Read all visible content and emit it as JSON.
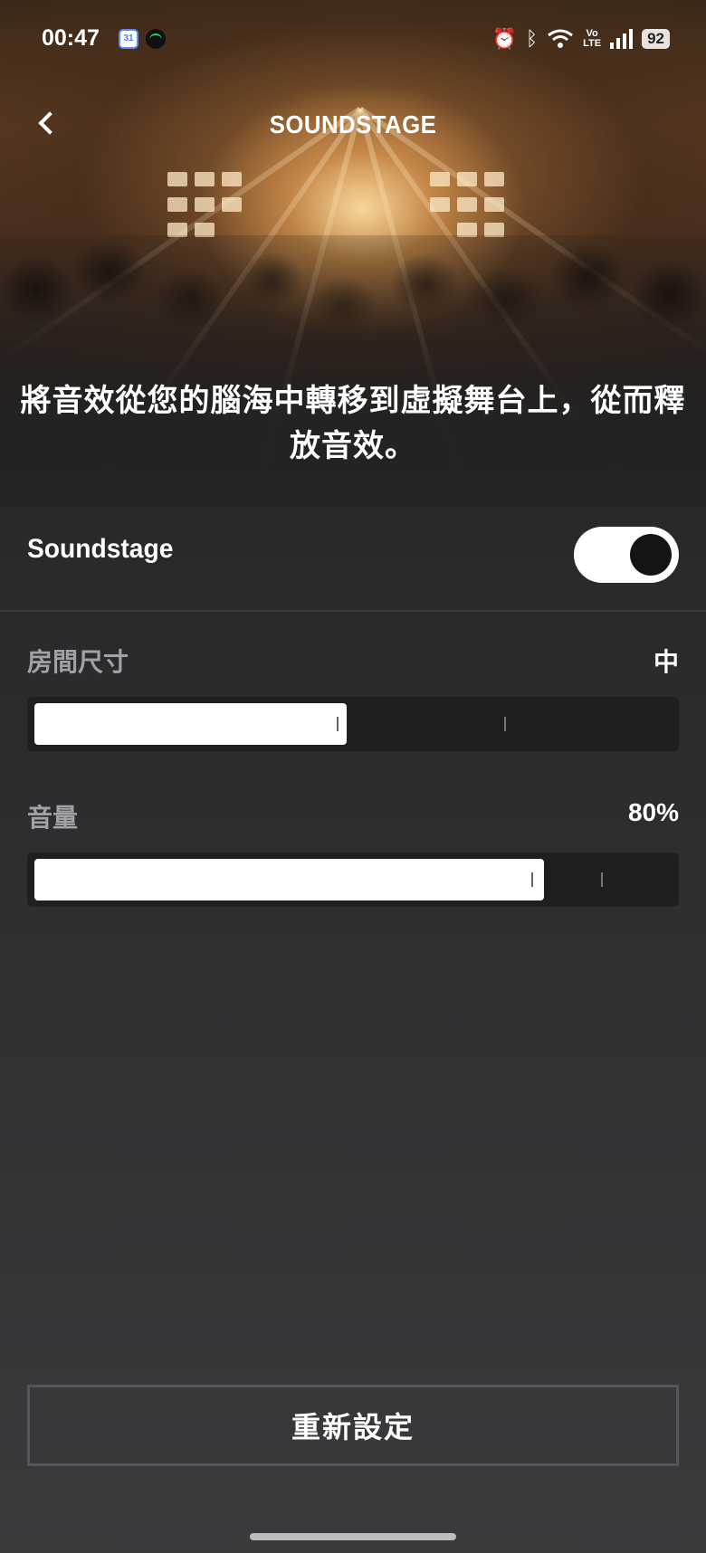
{
  "status_bar": {
    "time": "00:47",
    "calendar_badge": "31",
    "lte_label_top": "Vo",
    "lte_label_bottom": "LTE",
    "battery": "92"
  },
  "header": {
    "title": "SOUNDSTAGE"
  },
  "hero": {
    "tagline": "將音效從您的腦海中轉移到虛擬舞台上，從而釋放音效。"
  },
  "soundstage_toggle": {
    "label": "Soundstage",
    "enabled": true
  },
  "room_size": {
    "label": "房間尺寸",
    "value": "中",
    "level_fraction": 0.48
  },
  "volume": {
    "label": "音量",
    "value": "80%",
    "level_percent": 80
  },
  "reset_button": {
    "label": "重新設定"
  },
  "colors": {
    "background": "#2a2a2d",
    "slider_track": "#1f1f21",
    "slider_fill": "#ffffff",
    "label_muted": "#a2a2a6"
  }
}
